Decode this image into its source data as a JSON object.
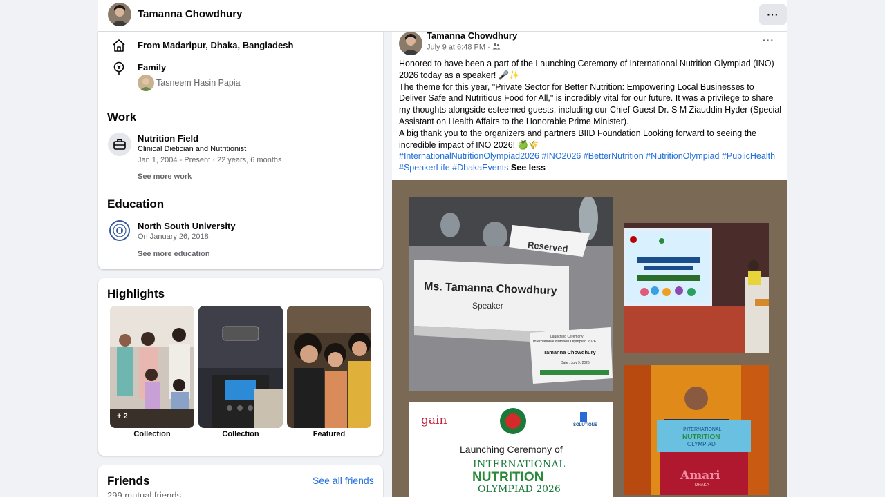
{
  "topbar": {
    "name": "Tamanna Chowdhury",
    "more_label": "···"
  },
  "about": {
    "from": "From Madaripur, Dhaka, Bangladesh",
    "family_label": "Family",
    "family_member": "Tasneem Hasin Papia",
    "work_heading": "Work",
    "work_title": "Nutrition Field",
    "work_role": "Clinical Dietician and Nutritionist",
    "work_dates": "Jan 1, 2004 - Present · 22 years, 6 months",
    "see_more_work": "See more work",
    "education_heading": "Education",
    "school": "North South University",
    "school_date": "On January 26, 2018",
    "see_more_education": "See more education"
  },
  "highlights": {
    "heading": "Highlights",
    "items": [
      {
        "caption": "Collection",
        "badge": "+ 2"
      },
      {
        "caption": "Collection"
      },
      {
        "caption": "Featured"
      }
    ]
  },
  "friends": {
    "heading": "Friends",
    "see_all": "See all friends",
    "mutual": "299 mutual friends"
  },
  "post": {
    "author": "Tamanna Chowdhury",
    "date": "July 9 at 6:48 PM",
    "privacy_sep": "·",
    "more_label": "···",
    "p1": "Honored to have been a part of the Launching Ceremony of International Nutrition Olympiad (INO) 2026 today as a speaker! 🎤✨",
    "p2": "The theme for this year, \"Private Sector for Better Nutrition: Empowering Local Businesses to Deliver Safe and Nutritious Food for All,\" is incredibly vital for our future. It was a privilege to share my thoughts alongside esteemed guests, including our Chief Guest Dr. S M Ziauddin Hyder (Special Assistant on Health Affairs to the Honorable Prime Minister).",
    "p3": "A big thank you to the organizers and partners BIID Foundation Looking forward to seeing the incredible impact of INO 2026! 🍏🌾",
    "hashtags": "#InternationalNutritionOlympiad2026 #INO2026 #BetterNutrition #NutritionOlympiad #PublicHealth #SpeakerLife #DhakaEvents",
    "see_less": "See less",
    "photo1": {
      "reserved": "Reserved",
      "name": "Ms. Tamanna Chowdhury",
      "role": "Speaker",
      "card_line1": "Launching Ceremony",
      "card_line2": "International Nutrition Olympiad 2026",
      "card_name": "Tamanna Chowdhury",
      "card_date": "Date : July 9, 2026"
    },
    "photo3": {
      "brand": "gain",
      "partner": "SOLUTIONS",
      "line1": "Launching Ceremony of",
      "line2": "INTERNATIONAL",
      "line3": "NUTRITION",
      "line4": "OLYMPIAD 2026"
    },
    "photo4": {
      "line1": "INTERNATIONAL",
      "line2": "NUTRITION",
      "line3": "OLYMPIAD",
      "brand": "Amari",
      "city": "DHAKA"
    }
  }
}
